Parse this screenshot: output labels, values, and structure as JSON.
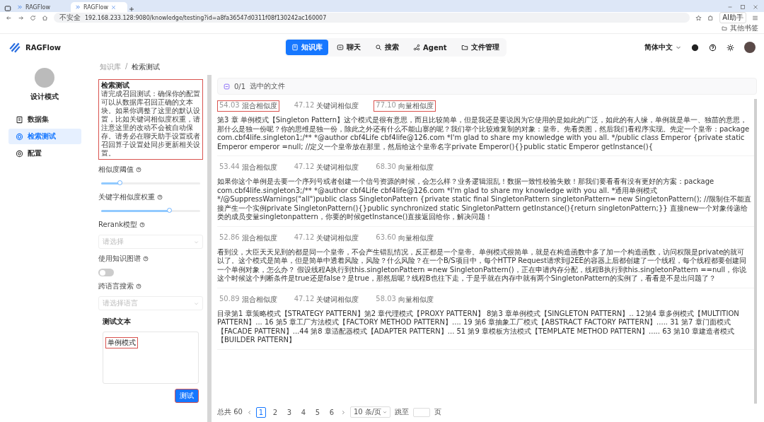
{
  "browser": {
    "tabs": [
      {
        "title": "RAGFlow",
        "selected": false
      },
      {
        "title": "RAGFlow",
        "selected": true
      }
    ],
    "security_label": "不安全",
    "url": "192.168.233.128:9080/knowledge/testing?id=a8fa36547d0311f08f130242ac160007",
    "ai_button": "AI助手",
    "bookmark_folder": "其他书签"
  },
  "app_header": {
    "logo": "RAGFlow",
    "nav": [
      {
        "label": "知识库",
        "selected": true
      },
      {
        "label": "聊天",
        "selected": false
      },
      {
        "label": "搜索",
        "selected": false
      },
      {
        "label": "Agent",
        "selected": false
      },
      {
        "label": "文件管理",
        "selected": false
      }
    ],
    "language": "简体中文"
  },
  "sidebar": {
    "dataset_name": "设计模式",
    "items": [
      {
        "label": "数据集",
        "selected": false
      },
      {
        "label": "检索测试",
        "selected": true
      },
      {
        "label": "配置",
        "selected": false
      }
    ]
  },
  "breadcrumb": {
    "items": [
      "知识库",
      "检索测试"
    ],
    "separator": "/"
  },
  "testing_panel": {
    "title": "检索测试",
    "description": "请完成召回测试：确保你的配置可以从数据库召回正确的文本块。如果你调整了这里的默认设置，比如关键词相似度权重，请注意这里的改动不会被自动保存。请务必在聊天助手设置或者召回算子设置处同步更新相关设置。",
    "highlighted": true,
    "fields": [
      {
        "kind": "slider",
        "label": "相似度阈值",
        "level": 0.2
      },
      {
        "kind": "slider",
        "label": "关键字相似度权重",
        "level": 0.7
      },
      {
        "kind": "select",
        "label": "Rerank模型",
        "placeholder": "请选择"
      },
      {
        "kind": "switch",
        "label": "使用知识图谱",
        "on": false
      },
      {
        "kind": "select",
        "label": "跨语言搜索",
        "placeholder": "请选择语言"
      }
    ],
    "test_text": {
      "label": "测试文本",
      "value": "单例模式",
      "highlighted": true
    },
    "test_button": {
      "label": "测试",
      "highlighted": true
    }
  },
  "results": {
    "selected_files": {
      "count": "0/1",
      "label": "选中的文件"
    },
    "chunks": [
      {
        "scores": [
          {
            "value": "54.03",
            "label": "混合相似度",
            "highlighted": true
          },
          {
            "value": "47.12",
            "label": "关键词相似度",
            "highlighted": false
          },
          {
            "value": "77.10",
            "label": "向量相似度",
            "highlighted": true
          }
        ],
        "text": "第3 章 单例模式【Singleton Pattern】这个模式是很有意思，而且比较简单，但是我还是要说因为它使用的是如此的广泛，如此的有人缘，单例就是单一、独苗的意思，那什么是独一份呢？你的思维是独一份，除此之外还有什么不能山寨的呢？我们举个比较难复制的对象：皇帝。先看类图，然后我们看程序实现。先定一个皇帝：package com.cbf4life.singleton1;/** *@author cbf4Life cbf4life@126.com *I'm glad to share my knowledge with you all. */public class Emperor {private static Emperor emperor =null; //定义一个皇帝放在那里，然后给这个皇帝名字private Emperor(){}public static Emperor getInstance(){"
      },
      {
        "scores": [
          {
            "value": "53.44",
            "label": "混合相似度",
            "highlighted": false
          },
          {
            "value": "47.12",
            "label": "关键词相似度",
            "highlighted": false
          },
          {
            "value": "68.30",
            "label": "向量相似度",
            "highlighted": false
          }
        ],
        "text": "如果你这个单例是去要一个序列号或者创建一个信号资源的时候，会怎么样？业务逻辑混乱！数据一致性校验失败！那我们要看看有没有更好的方案：package com.cbf4life.singleton3;/** *@author cbf4Life cbf4life@126.com *I'm glad to share my knowledge with you all. *通用单例模式 */@SuppressWarnings(\"all\")public class SingletonPattern {private static final SingletonPattern singletonPattern= new SingletonPattern(); //限制住不能直接产生一个实例private SingletonPattern(){}public synchronized static SingletonPattern getInstance(){return singletonPattern;}} 直接new一个对象传递给类的成员变量singletonpattern，你要的时候getInstance()直接返回给你，解决问题！"
      },
      {
        "scores": [
          {
            "value": "52.86",
            "label": "混合相似度",
            "highlighted": false
          },
          {
            "value": "47.12",
            "label": "关键词相似度",
            "highlighted": false
          },
          {
            "value": "63.60",
            "label": "向量相似度",
            "highlighted": false
          }
        ],
        "text": "看到没，大臣天天见到的都是同一个皇帝，不会产生错乱情况，反正都是一个皇帝。单例模式很简单，就是在构造函数中多了加一个构造函数，访问权限是private的就可以了。这个模式是简单，但是简单中透着风险，风险？什么风险？在一个B/S项目中，每个HTTP Request请求到J2EE的容器上后都创建了一个线程，每个线程都要创建同一个单例对象，怎么办？ 假设线程A执行到this.singletonPattern =new SingletonPattern()，正在申请内存分配，线程B执行到this.singletonPattern ==null，你说这个时候这个判断条件是true还是false？是true，那然后呢？线程B也往下走，于是乎就在内存中就有两个SingletonPattern的实例了，看看是不是出问题了？"
      },
      {
        "scores": [
          {
            "value": "50.89",
            "label": "混合相似度",
            "highlighted": false
          },
          {
            "value": "47.12",
            "label": "关键词相似度",
            "highlighted": false
          },
          {
            "value": "58.03",
            "label": "向量相似度",
            "highlighted": false
          }
        ],
        "text": "目录第1 章策略模式【STRATEGY PATTERN】第2 章代理模式【PROXY PATTERN】 8第3 章单例模式【SINGLETON PATTERN】.. 12第4 章多例模式【MULTITION PATTERN】... 16 第5 章工厂方法模式【FACTORY METHOD PATTERN】.... 19 第6 章抽象工厂模式【ABSTRACT FACTORY PATTERN】..... 31 第7 章门面模式【FACADE PATTERN】...44 第8 章适配器模式【ADAPTER PATTERN】... 51 第9 章模板方法模式【TEMPLATE METHOD PATTERN】..... 63 第10 章建造者模式【BUILDER PATTERN】"
      }
    ]
  },
  "pagination": {
    "total": "总共 60",
    "pages": [
      {
        "label": "1",
        "selected": true
      },
      {
        "label": "2",
        "selected": false
      },
      {
        "label": "3",
        "selected": false
      },
      {
        "label": "4",
        "selected": false
      },
      {
        "label": "5",
        "selected": false
      },
      {
        "label": "6",
        "selected": false
      }
    ],
    "page_size": "10 条/页",
    "jump_label": "跳至",
    "jump_suffix": "页"
  }
}
